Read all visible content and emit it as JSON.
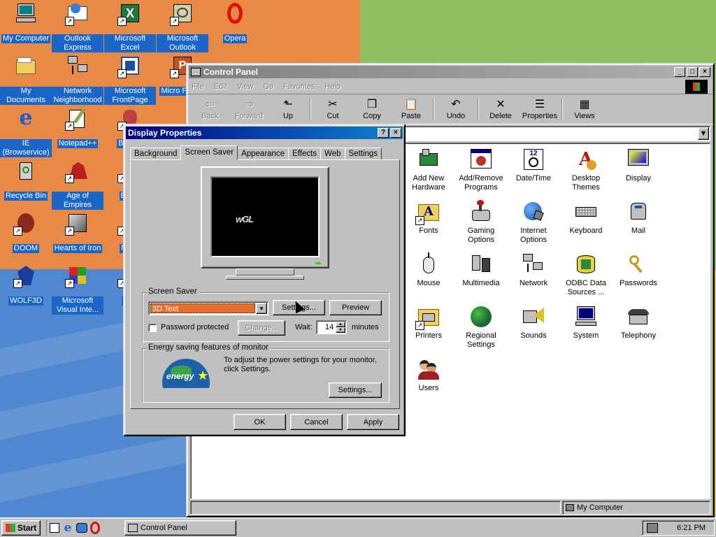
{
  "desktop": {
    "icons": [
      {
        "label": "My Computer",
        "icon": "my-computer-icon"
      },
      {
        "label": "Outlook Express",
        "icon": "outlook-express-icon"
      },
      {
        "label": "Microsoft Excel",
        "icon": "excel-icon"
      },
      {
        "label": "Microsoft Outlook",
        "icon": "outlook-icon"
      },
      {
        "label": "Opera",
        "icon": "opera-icon"
      },
      {
        "label": "My Documents",
        "icon": "folder-icon"
      },
      {
        "label": "Network Neighborhood",
        "icon": "network-icon"
      },
      {
        "label": "Microsoft FrontPage",
        "icon": "frontpage-icon"
      },
      {
        "label": "Micro Power",
        "icon": "powerpoint-icon"
      },
      {
        "label": "IE (Browservice)",
        "icon": "ie-icon"
      },
      {
        "label": "Notepad++",
        "icon": "notepad-icon"
      },
      {
        "label": "Bete D",
        "icon": "app-icon"
      },
      {
        "label": "Recycle Bin",
        "icon": "recycle-bin-icon"
      },
      {
        "label": "Age of Empires",
        "icon": "age-of-empires-icon"
      },
      {
        "label": "Big D",
        "icon": "app-icon"
      },
      {
        "label": "DOOM",
        "icon": "doom-icon"
      },
      {
        "label": "Hearts of Iron",
        "icon": "hearts-of-iron-icon"
      },
      {
        "label": "Pagg",
        "icon": "app-icon"
      },
      {
        "label": "WOLF3D",
        "icon": "wolf3d-icon"
      },
      {
        "label": "Microsoft Visual Inte...",
        "icon": "visual-interdev-icon"
      },
      {
        "label": "Pl Z",
        "icon": "app-icon"
      }
    ]
  },
  "control_panel": {
    "title": "Control Panel",
    "menu": [
      "File",
      "Edit",
      "View",
      "Go",
      "Favorites",
      "Help"
    ],
    "toolbar": [
      {
        "label": "Back",
        "enabled": false
      },
      {
        "label": "Forward",
        "enabled": false
      },
      {
        "label": "Up",
        "enabled": true
      },
      {
        "label": "Cut",
        "enabled": true
      },
      {
        "label": "Copy",
        "enabled": true
      },
      {
        "label": "Paste",
        "enabled": true
      },
      {
        "label": "Undo",
        "enabled": true
      },
      {
        "label": "Delete",
        "enabled": true
      },
      {
        "label": "Properties",
        "enabled": true
      },
      {
        "label": "Views",
        "enabled": true
      }
    ],
    "items": [
      {
        "label": "Add New Hardware",
        "icon": "add-hardware-icon"
      },
      {
        "label": "Add/Remove Programs",
        "icon": "add-remove-programs-icon"
      },
      {
        "label": "Date/Time",
        "icon": "date-time-icon"
      },
      {
        "label": "Desktop Themes",
        "icon": "desktop-themes-icon"
      },
      {
        "label": "Display",
        "icon": "display-icon"
      },
      {
        "label": "Fonts",
        "icon": "fonts-icon"
      },
      {
        "label": "Gaming Options",
        "icon": "gaming-options-icon"
      },
      {
        "label": "Internet Options",
        "icon": "internet-options-icon"
      },
      {
        "label": "Keyboard",
        "icon": "keyboard-icon"
      },
      {
        "label": "Mail",
        "icon": "mail-icon"
      },
      {
        "label": "Mouse",
        "icon": "mouse-icon"
      },
      {
        "label": "Multimedia",
        "icon": "multimedia-icon"
      },
      {
        "label": "Network",
        "icon": "network-icon"
      },
      {
        "label": "ODBC Data Sources ...",
        "icon": "odbc-icon"
      },
      {
        "label": "Passwords",
        "icon": "passwords-icon"
      },
      {
        "label": "Printers",
        "icon": "printers-icon"
      },
      {
        "label": "Regional Settings",
        "icon": "regional-settings-icon"
      },
      {
        "label": "Sounds",
        "icon": "sounds-icon"
      },
      {
        "label": "System",
        "icon": "system-icon"
      },
      {
        "label": "Telephony",
        "icon": "telephony-icon"
      },
      {
        "label": "Users",
        "icon": "users-icon"
      }
    ],
    "status_zone": "My Computer"
  },
  "display_properties": {
    "title": "Display Properties",
    "tabs": [
      "Background",
      "Screen Saver",
      "Appearance",
      "Effects",
      "Web",
      "Settings"
    ],
    "active_tab": "Screen Saver",
    "preview_text": "wGL",
    "screensaver_group_label": "Screen Saver",
    "screensaver_selected": "3D Text",
    "settings_button": "Settings...",
    "preview_button": "Preview",
    "password_label": "Password protected",
    "password_checked": false,
    "change_button": "Change...",
    "wait_label": "Wait:",
    "wait_value": "14",
    "minutes_label": "minutes",
    "energy_group_label": "Energy saving features of monitor",
    "energy_text": "To adjust the power settings for your monitor, click Settings.",
    "energy_logo_text": "energy",
    "energy_settings_button": "Settings...",
    "ok_button": "OK",
    "cancel_button": "Cancel",
    "apply_button": "Apply"
  },
  "taskbar": {
    "start_label": "Start",
    "quick_launch": [
      "show-desktop-icon",
      "ie-icon",
      "outlook-express-icon",
      "opera-icon"
    ],
    "tasks": [
      {
        "label": "Control Panel"
      }
    ],
    "clock": "6:21 PM"
  },
  "colors": {
    "title_active": "#000080",
    "desktop_selection": "#1a66c8",
    "screensaver_highlight": "#e8702a"
  }
}
